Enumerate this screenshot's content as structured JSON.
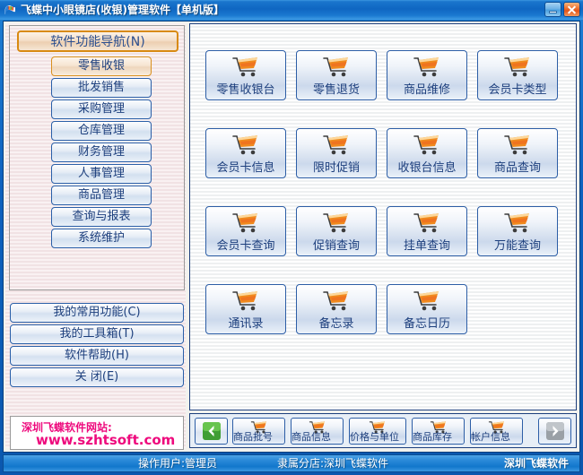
{
  "window": {
    "title": "飞蝶中小眼镜店(收银)管理软件【单机版】",
    "icon": "app-flag-icon",
    "minimize_label": "最小化",
    "close_label": "关闭"
  },
  "sidebar": {
    "nav_header": {
      "label": "软件功能导航(N)",
      "accent": "#d88a12"
    },
    "nav_items": [
      {
        "label": "零售收银",
        "selected": true
      },
      {
        "label": "批发销售",
        "selected": false
      },
      {
        "label": "采购管理",
        "selected": false
      },
      {
        "label": "仓库管理",
        "selected": false
      },
      {
        "label": "财务管理",
        "selected": false
      },
      {
        "label": "人事管理",
        "selected": false
      },
      {
        "label": "商品管理",
        "selected": false
      },
      {
        "label": "查询与报表",
        "selected": false
      },
      {
        "label": "系统维护",
        "selected": false
      }
    ],
    "bottom_buttons": [
      {
        "label": "我的常用功能(C)"
      },
      {
        "label": "我的工具箱(T)"
      },
      {
        "label": "软件帮助(H)"
      },
      {
        "label": "关  闭(E)"
      }
    ],
    "website_panel": {
      "line1": "深圳飞蝶软件网站:",
      "line2": "www.szhtsoft.com",
      "color": "#ee0a7d"
    }
  },
  "main": {
    "buttons": [
      {
        "label": "零售收银台",
        "icon": "shopping-cart-icon"
      },
      {
        "label": "零售退货",
        "icon": "shopping-cart-icon"
      },
      {
        "label": "商品维修",
        "icon": "shopping-cart-icon"
      },
      {
        "label": "会员卡类型",
        "icon": "shopping-cart-icon"
      },
      {
        "label": "会员卡信息",
        "icon": "shopping-cart-icon"
      },
      {
        "label": "限时促销",
        "icon": "shopping-cart-icon"
      },
      {
        "label": "收银台信息",
        "icon": "shopping-cart-icon"
      },
      {
        "label": "商品查询",
        "icon": "shopping-cart-icon"
      },
      {
        "label": "会员卡查询",
        "icon": "shopping-cart-icon"
      },
      {
        "label": "促销查询",
        "icon": "shopping-cart-icon"
      },
      {
        "label": "挂单查询",
        "icon": "shopping-cart-icon"
      },
      {
        "label": "万能查询",
        "icon": "shopping-cart-icon"
      },
      {
        "label": "通讯录",
        "icon": "shopping-cart-icon"
      },
      {
        "label": "备忘录",
        "icon": "shopping-cart-icon"
      },
      {
        "label": "备忘日历",
        "icon": "shopping-cart-icon"
      }
    ]
  },
  "bottom_toolbar": {
    "prev_label": "◀",
    "next_label": "▶",
    "buttons": [
      {
        "label": "商品批号",
        "icon": "shopping-cart-icon"
      },
      {
        "label": "商品信息",
        "icon": "shopping-cart-icon"
      },
      {
        "label": "价格与单位",
        "icon": "shopping-cart-icon"
      },
      {
        "label": "商品库存",
        "icon": "shopping-cart-icon"
      },
      {
        "label": "帐户信息",
        "icon": "shopping-cart-icon"
      }
    ]
  },
  "statusbar": {
    "user": "操作用户:管理员",
    "branch": "隶属分店:深圳飞蝶软件",
    "brand": "深圳飞蝶软件"
  }
}
